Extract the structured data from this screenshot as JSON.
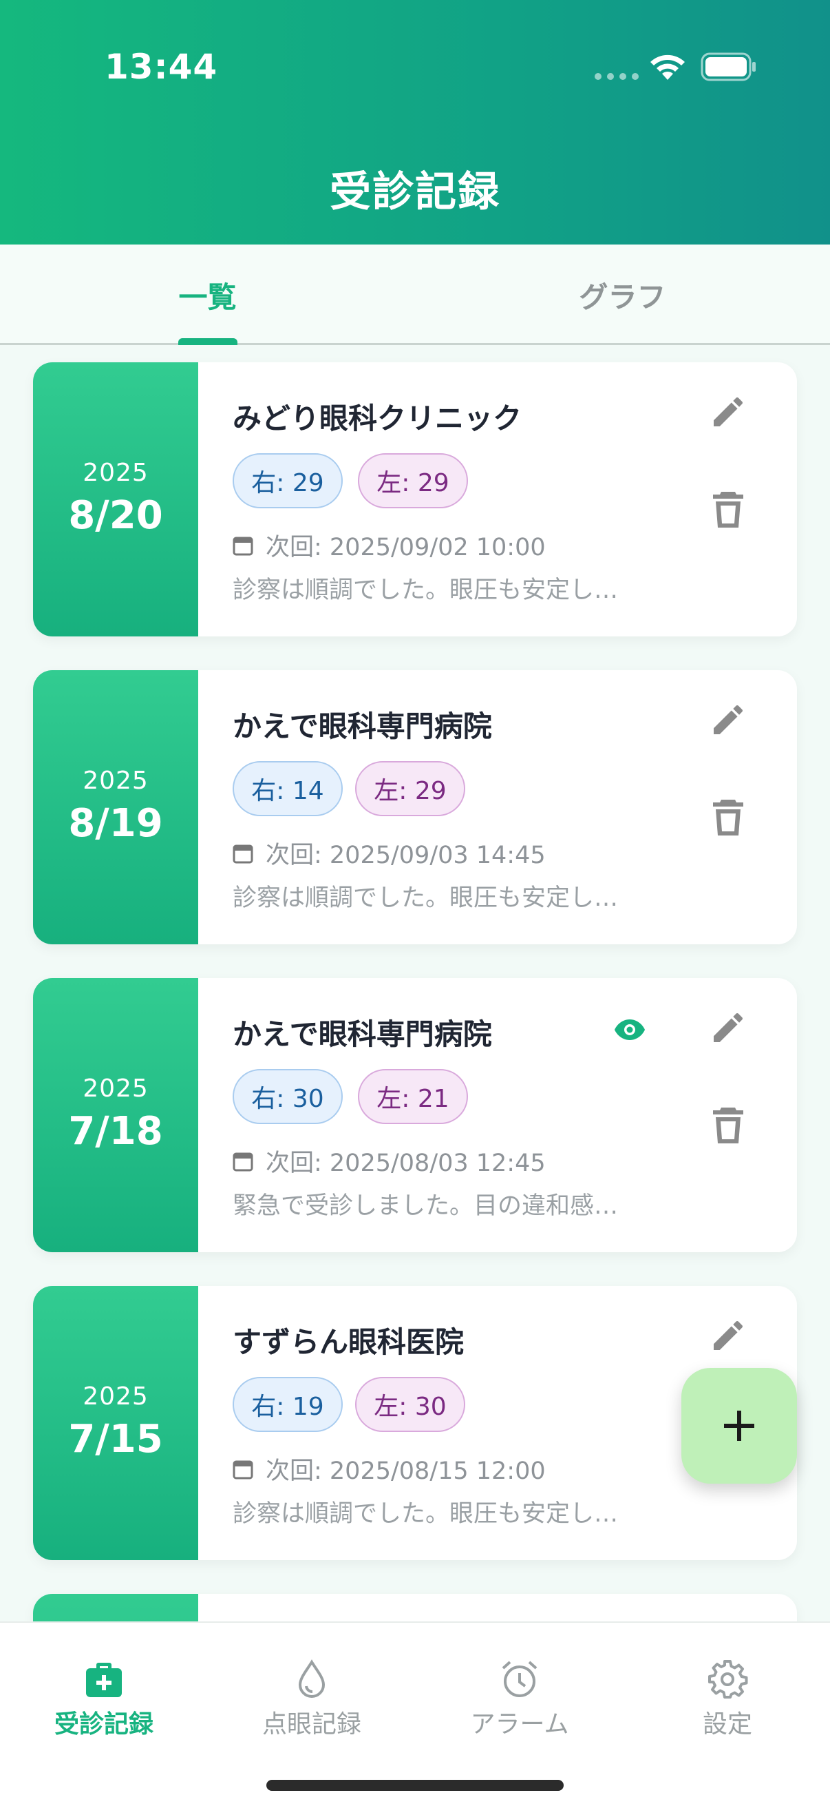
{
  "status_bar": {
    "time": "13:44"
  },
  "header": {
    "title": "受診記録"
  },
  "tabs": [
    {
      "label": "一覧",
      "active": true
    },
    {
      "label": "グラフ",
      "active": false
    }
  ],
  "records": [
    {
      "year": "2025",
      "date": "8/20",
      "clinic": "みどり眼科クリニック",
      "right": "右: 29",
      "left": "左: 29",
      "next": "次回: 2025/09/02 10:00",
      "note": "診察は順調でした。眼圧も安定し…",
      "has_eye_icon": false
    },
    {
      "year": "2025",
      "date": "8/19",
      "clinic": "かえで眼科専門病院",
      "right": "右: 14",
      "left": "左: 29",
      "next": "次回: 2025/09/03 14:45",
      "note": "診察は順調でした。眼圧も安定し…",
      "has_eye_icon": false
    },
    {
      "year": "2025",
      "date": "7/18",
      "clinic": "かえで眼科専門病院",
      "right": "右: 30",
      "left": "左: 21",
      "next": "次回: 2025/08/03 12:45",
      "note": "緊急で受診しました。目の違和感…",
      "has_eye_icon": true
    },
    {
      "year": "2025",
      "date": "7/15",
      "clinic": "すずらん眼科医院",
      "right": "右: 19",
      "left": "左: 30",
      "next": "次回: 2025/08/15 12:00",
      "note": "診察は順調でした。眼圧も安定し…",
      "has_eye_icon": false
    }
  ],
  "bottom_nav": [
    {
      "label": "受診記録",
      "icon": "medical-kit-icon",
      "active": true
    },
    {
      "label": "点眼記録",
      "icon": "drop-icon",
      "active": false
    },
    {
      "label": "アラーム",
      "icon": "alarm-icon",
      "active": false
    },
    {
      "label": "設定",
      "icon": "gear-icon",
      "active": false
    }
  ],
  "colors": {
    "accent": "#17b380",
    "header_start": "#15b87e",
    "header_end": "#11918a",
    "fab": "#bff0b8"
  }
}
